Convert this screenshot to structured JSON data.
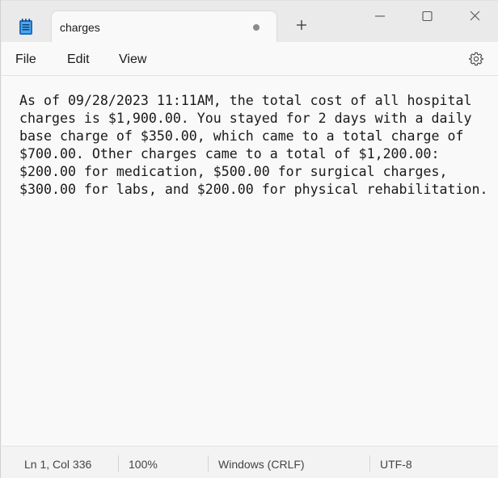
{
  "tab": {
    "title": "charges",
    "unsaved": true
  },
  "menu": {
    "file": "File",
    "edit": "Edit",
    "view": "View"
  },
  "editor": {
    "lines": [
      "As of 09/28/2023 11:11AM, the total cost of all hospital",
      "charges is $1,900.00. You stayed for 2 days with a daily",
      "base charge of $350.00, which came to a total charge of",
      "$700.00. Other charges came to a total of $1,200.00:",
      "$200.00 for medication, $500.00 for surgical charges,",
      "$300.00 for labs, and $200.00 for physical rehabilitation."
    ]
  },
  "status": {
    "position": "Ln 1, Col 336",
    "zoom": "100%",
    "line_ending": "Windows (CRLF)",
    "encoding": "UTF-8"
  },
  "icons": {
    "app": "notepad-icon",
    "new_tab": "plus-icon",
    "minimize": "minimize-icon",
    "maximize": "maximize-icon",
    "close": "close-icon",
    "settings": "gear-icon"
  }
}
